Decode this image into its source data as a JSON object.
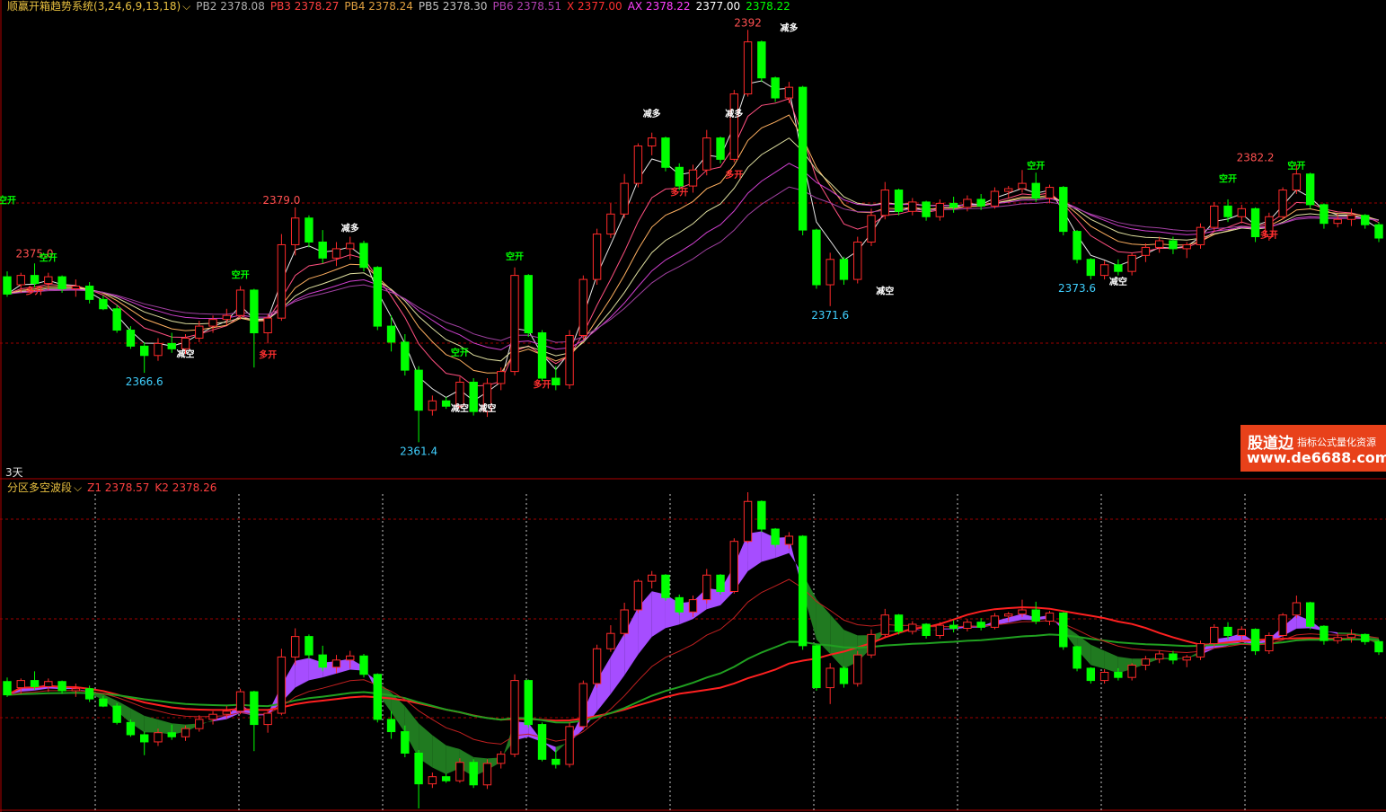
{
  "header_top": {
    "name": "顺赢开箱趋势系统",
    "params": "(3,24,6,9,13,18)",
    "dropdown_icon": "chevron-down-icon",
    "items": [
      {
        "label": "PB2",
        "value": "2378.08",
        "color": "#b0b0b0"
      },
      {
        "label": "PB3",
        "value": "2378.27",
        "color": "#ff4040"
      },
      {
        "label": "PB4",
        "value": "2378.24",
        "color": "#e0a040"
      },
      {
        "label": "PB5",
        "value": "2378.30",
        "color": "#c0c0c0"
      },
      {
        "label": "PB6",
        "value": "2378.51",
        "color": "#b040b0"
      },
      {
        "label": "X",
        "value": "2377.00",
        "color": "#ff3030"
      },
      {
        "label": "AX",
        "value": "2378.22",
        "color": "#ff40ff"
      },
      {
        "label": "",
        "value": "2377.00",
        "color": "#ffffff"
      },
      {
        "label": "",
        "value": "2378.22",
        "color": "#00ff00"
      }
    ]
  },
  "header_bottom": {
    "name": "分区多空波段",
    "dropdown_icon": "chevron-down-icon",
    "items": [
      {
        "label": "Z1",
        "value": "2378.57",
        "color": "#ff4040"
      },
      {
        "label": "K2",
        "value": "2378.26",
        "color": "#ff4040"
      }
    ]
  },
  "period_label": "3天",
  "watermark": {
    "brand": "股道边",
    "tagline": "指标公式量化资源",
    "url": "www.de6688.com"
  },
  "colors": {
    "up": "#ff2a2a",
    "down": "#00ff00",
    "green_band": "#207a20",
    "purple_band": "#a64dff",
    "grid": "#a00000"
  },
  "chart_data": {
    "type": "candlestick",
    "price_range": [
      2359,
      2394
    ],
    "price_labels": [
      {
        "text": "2392",
        "bar": 54,
        "price": 2392.3,
        "color": "#ff5050"
      },
      {
        "text": "2379.0",
        "bar": 20,
        "price": 2379.0,
        "color": "#ff5050"
      },
      {
        "text": "2375.0",
        "bar": 2,
        "price": 2375.0,
        "color": "#ff5050"
      },
      {
        "text": "2382.2",
        "bar": 91,
        "price": 2382.2,
        "color": "#ff5050"
      },
      {
        "text": "2366.6",
        "bar": 10,
        "price": 2366.6,
        "color": "#40d0ff"
      },
      {
        "text": "2361.4",
        "bar": 30,
        "price": 2361.4,
        "color": "#40d0ff"
      },
      {
        "text": "2371.6",
        "bar": 60,
        "price": 2371.6,
        "color": "#40d0ff"
      },
      {
        "text": "2373.6",
        "bar": 78,
        "price": 2373.6,
        "color": "#40d0ff"
      }
    ],
    "signals": [
      {
        "text": "空开",
        "bar": 0,
        "price": 2379.3,
        "color": "#00ff00"
      },
      {
        "text": "空开",
        "bar": 3,
        "price": 2375.0,
        "color": "#00ff00"
      },
      {
        "text": "多开",
        "bar": 2,
        "price": 2372.5,
        "color": "#ff3030"
      },
      {
        "text": "空开",
        "bar": 17,
        "price": 2373.7,
        "color": "#00ff00"
      },
      {
        "text": "减空",
        "bar": 13,
        "price": 2367.8,
        "color": "#ffffff"
      },
      {
        "text": "多开",
        "bar": 19,
        "price": 2367.7,
        "color": "#ff3030"
      },
      {
        "text": "减多",
        "bar": 25,
        "price": 2377.2,
        "color": "#ffffff"
      },
      {
        "text": "空开",
        "bar": 33,
        "price": 2367.9,
        "color": "#00ff00"
      },
      {
        "text": "减空",
        "bar": 33,
        "price": 2363.7,
        "color": "#ffffff"
      },
      {
        "text": "减空",
        "bar": 35,
        "price": 2363.7,
        "color": "#ffffff"
      },
      {
        "text": "空开",
        "bar": 37,
        "price": 2375.1,
        "color": "#00ff00"
      },
      {
        "text": "多开",
        "bar": 39,
        "price": 2365.5,
        "color": "#ff3030"
      },
      {
        "text": "减多",
        "bar": 47,
        "price": 2385.8,
        "color": "#ffffff"
      },
      {
        "text": "减多",
        "bar": 53,
        "price": 2385.8,
        "color": "#ffffff"
      },
      {
        "text": "多开",
        "bar": 49,
        "price": 2379.9,
        "color": "#ff3030"
      },
      {
        "text": "多开",
        "bar": 53,
        "price": 2381.2,
        "color": "#ff3030"
      },
      {
        "text": "减多",
        "bar": 57,
        "price": 2392.2,
        "color": "#ffffff"
      },
      {
        "text": "减空",
        "bar": 64,
        "price": 2372.5,
        "color": "#ffffff"
      },
      {
        "text": "空开",
        "bar": 75,
        "price": 2381.9,
        "color": "#00ff00"
      },
      {
        "text": "减空",
        "bar": 81,
        "price": 2373.2,
        "color": "#ffffff"
      },
      {
        "text": "空开",
        "bar": 89,
        "price": 2380.9,
        "color": "#00ff00"
      },
      {
        "text": "多开",
        "bar": 92,
        "price": 2376.7,
        "color": "#ff3030"
      },
      {
        "text": "空开",
        "bar": 94,
        "price": 2381.9,
        "color": "#00ff00"
      }
    ],
    "ohlc": [
      [
        2373.8,
        2374.2,
        2372.3,
        2372.5
      ],
      [
        2373.2,
        2374.1,
        2372.6,
        2373.9
      ],
      [
        2373.9,
        2374.8,
        2373.0,
        2373.3
      ],
      [
        2373.3,
        2374.1,
        2372.8,
        2373.8
      ],
      [
        2373.8,
        2373.9,
        2372.6,
        2372.9
      ],
      [
        2372.9,
        2373.6,
        2372.3,
        2373.1
      ],
      [
        2373.1,
        2373.4,
        2371.8,
        2372.1
      ],
      [
        2372.1,
        2372.4,
        2371.3,
        2371.4
      ],
      [
        2371.4,
        2371.7,
        2369.6,
        2369.8
      ],
      [
        2369.8,
        2370.1,
        2368.4,
        2368.6
      ],
      [
        2368.6,
        2368.9,
        2366.6,
        2367.9
      ],
      [
        2367.9,
        2369.2,
        2367.5,
        2368.8
      ],
      [
        2368.8,
        2369.6,
        2368.1,
        2368.4
      ],
      [
        2368.4,
        2369.5,
        2368.0,
        2369.2
      ],
      [
        2369.2,
        2370.5,
        2368.9,
        2370.1
      ],
      [
        2370.1,
        2370.9,
        2369.6,
        2370.6
      ],
      [
        2370.6,
        2371.4,
        2370.2,
        2370.9
      ],
      [
        2370.9,
        2373.1,
        2370.6,
        2372.8
      ],
      [
        2372.8,
        2372.9,
        2367.0,
        2369.6
      ],
      [
        2369.6,
        2371.0,
        2368.8,
        2370.7
      ],
      [
        2370.7,
        2377.0,
        2370.5,
        2376.2
      ],
      [
        2376.2,
        2379.0,
        2375.4,
        2378.2
      ],
      [
        2378.2,
        2378.4,
        2376.0,
        2376.4
      ],
      [
        2376.4,
        2377.3,
        2374.8,
        2375.2
      ],
      [
        2375.2,
        2376.4,
        2374.6,
        2375.9
      ],
      [
        2375.9,
        2376.8,
        2375.1,
        2376.3
      ],
      [
        2376.3,
        2376.5,
        2374.2,
        2374.5
      ],
      [
        2374.5,
        2374.6,
        2369.8,
        2370.1
      ],
      [
        2370.1,
        2370.9,
        2368.2,
        2368.9
      ],
      [
        2368.9,
        2369.5,
        2366.4,
        2366.8
      ],
      [
        2366.8,
        2367.1,
        2361.4,
        2363.8
      ],
      [
        2363.8,
        2364.9,
        2363.4,
        2364.5
      ],
      [
        2364.5,
        2364.8,
        2363.9,
        2364.1
      ],
      [
        2364.1,
        2366.3,
        2363.9,
        2365.9
      ],
      [
        2365.9,
        2366.2,
        2363.4,
        2363.7
      ],
      [
        2363.7,
        2366.2,
        2363.3,
        2365.8
      ],
      [
        2365.8,
        2367.0,
        2365.3,
        2366.7
      ],
      [
        2366.7,
        2374.5,
        2366.4,
        2373.9
      ],
      [
        2373.9,
        2374.0,
        2369.3,
        2369.6
      ],
      [
        2369.6,
        2369.8,
        2366.0,
        2366.2
      ],
      [
        2366.2,
        2367.1,
        2365.3,
        2365.7
      ],
      [
        2365.7,
        2369.8,
        2365.4,
        2369.4
      ],
      [
        2369.4,
        2373.9,
        2369.1,
        2373.6
      ],
      [
        2373.6,
        2377.4,
        2373.2,
        2377.0
      ],
      [
        2377.0,
        2379.3,
        2376.7,
        2378.5
      ],
      [
        2378.5,
        2381.5,
        2378.2,
        2380.8
      ],
      [
        2380.8,
        2383.8,
        2380.5,
        2383.6
      ],
      [
        2383.6,
        2384.6,
        2382.9,
        2384.2
      ],
      [
        2384.2,
        2384.3,
        2381.7,
        2382.0
      ],
      [
        2382.0,
        2382.3,
        2380.3,
        2380.6
      ],
      [
        2380.6,
        2382.2,
        2380.1,
        2381.8
      ],
      [
        2381.8,
        2384.8,
        2381.4,
        2384.2
      ],
      [
        2384.2,
        2384.3,
        2382.3,
        2382.6
      ],
      [
        2382.6,
        2387.8,
        2382.4,
        2387.5
      ],
      [
        2387.5,
        2392.3,
        2387.3,
        2391.4
      ],
      [
        2391.4,
        2391.5,
        2388.4,
        2388.7
      ],
      [
        2388.7,
        2388.8,
        2386.9,
        2387.2
      ],
      [
        2387.2,
        2388.4,
        2386.8,
        2388.0
      ],
      [
        2388.0,
        2388.1,
        2376.9,
        2377.3
      ],
      [
        2377.3,
        2377.4,
        2372.9,
        2373.2
      ],
      [
        2373.2,
        2375.6,
        2371.6,
        2375.1
      ],
      [
        2375.1,
        2375.3,
        2373.2,
        2373.6
      ],
      [
        2373.6,
        2376.8,
        2373.3,
        2376.4
      ],
      [
        2376.4,
        2378.9,
        2376.1,
        2378.4
      ],
      [
        2378.4,
        2380.9,
        2378.1,
        2380.3
      ],
      [
        2380.3,
        2380.4,
        2378.4,
        2378.7
      ],
      [
        2378.7,
        2379.7,
        2378.4,
        2379.4
      ],
      [
        2379.4,
        2379.5,
        2378.0,
        2378.3
      ],
      [
        2378.3,
        2379.6,
        2378.0,
        2379.3
      ],
      [
        2379.3,
        2379.8,
        2378.6,
        2379.0
      ],
      [
        2379.0,
        2379.9,
        2378.7,
        2379.6
      ],
      [
        2379.6,
        2380.0,
        2378.8,
        2379.1
      ],
      [
        2379.1,
        2380.5,
        2378.9,
        2380.2
      ],
      [
        2380.2,
        2380.6,
        2379.7,
        2380.4
      ],
      [
        2380.4,
        2381.8,
        2380.1,
        2380.8
      ],
      [
        2380.8,
        2381.6,
        2379.4,
        2379.7
      ],
      [
        2379.7,
        2380.7,
        2379.3,
        2380.5
      ],
      [
        2380.5,
        2380.6,
        2376.9,
        2377.2
      ],
      [
        2377.2,
        2377.3,
        2374.8,
        2375.1
      ],
      [
        2375.1,
        2375.2,
        2373.6,
        2373.9
      ],
      [
        2373.9,
        2375.0,
        2373.6,
        2374.7
      ],
      [
        2374.7,
        2375.1,
        2373.9,
        2374.2
      ],
      [
        2374.2,
        2375.6,
        2373.9,
        2375.4
      ],
      [
        2375.4,
        2376.3,
        2374.9,
        2376.0
      ],
      [
        2376.0,
        2376.8,
        2375.6,
        2376.5
      ],
      [
        2376.5,
        2376.8,
        2375.5,
        2375.9
      ],
      [
        2375.9,
        2376.4,
        2375.2,
        2376.2
      ],
      [
        2376.2,
        2377.8,
        2375.9,
        2377.5
      ],
      [
        2377.5,
        2379.4,
        2377.2,
        2379.1
      ],
      [
        2379.1,
        2379.6,
        2377.9,
        2378.3
      ],
      [
        2378.3,
        2379.2,
        2377.8,
        2378.9
      ],
      [
        2378.9,
        2379.0,
        2376.4,
        2376.8
      ],
      [
        2376.8,
        2378.6,
        2376.5,
        2378.3
      ],
      [
        2378.3,
        2380.5,
        2378.1,
        2380.3
      ],
      [
        2380.3,
        2382.2,
        2380.0,
        2381.5
      ],
      [
        2381.5,
        2381.6,
        2378.9,
        2379.2
      ],
      [
        2379.2,
        2379.3,
        2377.4,
        2377.8
      ],
      [
        2377.8,
        2378.5,
        2377.5,
        2378.1
      ],
      [
        2378.1,
        2378.9,
        2377.6,
        2378.4
      ],
      [
        2378.4,
        2378.5,
        2377.4,
        2377.7
      ],
      [
        2377.7,
        2377.9,
        2376.4,
        2376.7
      ]
    ]
  }
}
